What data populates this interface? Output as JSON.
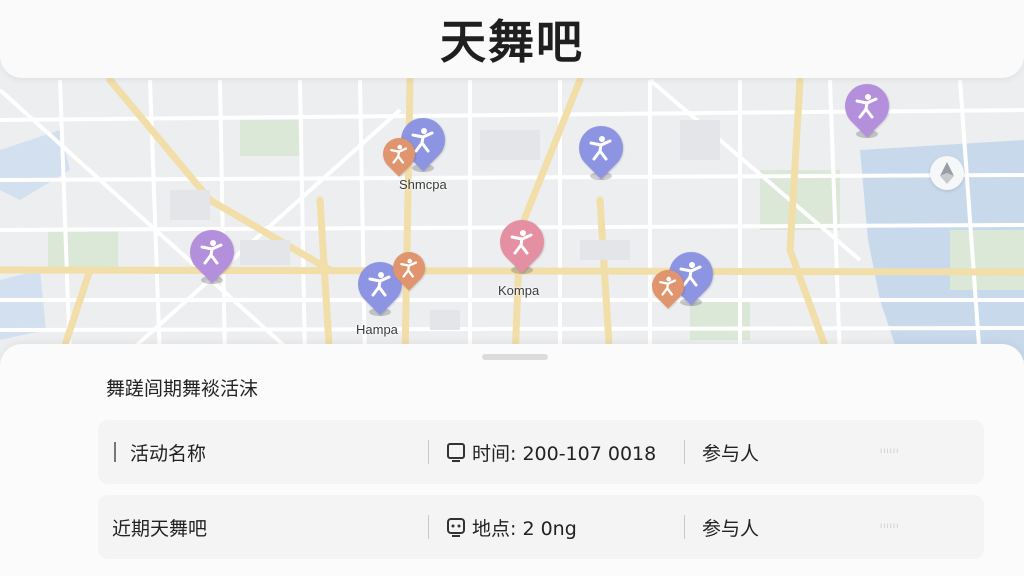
{
  "app": {
    "title": "天舞吧"
  },
  "map": {
    "labels": [
      "Shmcpa",
      "Kompa",
      "Hampa"
    ],
    "icons": {
      "pin": "dancer-pin-icon",
      "compass": "compass-icon"
    },
    "colors": {
      "blue": "#8d95e2",
      "purple": "#b48fdc",
      "pink": "#e58fa2",
      "orange": "#e0956e",
      "water": "#c9d9ec",
      "park": "#d9e7d7",
      "road": "#f0dca8"
    }
  },
  "sheet": {
    "section_title": "舞蹉闾期舞裧活沫",
    "cards": [
      {
        "name": "活动名称",
        "time": "时间: 200-107 0018",
        "participants": "参与人",
        "dots": "ıııııı"
      },
      {
        "name": "近期天舞吧",
        "place": "地点: 2 0ng",
        "participants": "参与人",
        "dots": "ıııııı"
      }
    ]
  }
}
